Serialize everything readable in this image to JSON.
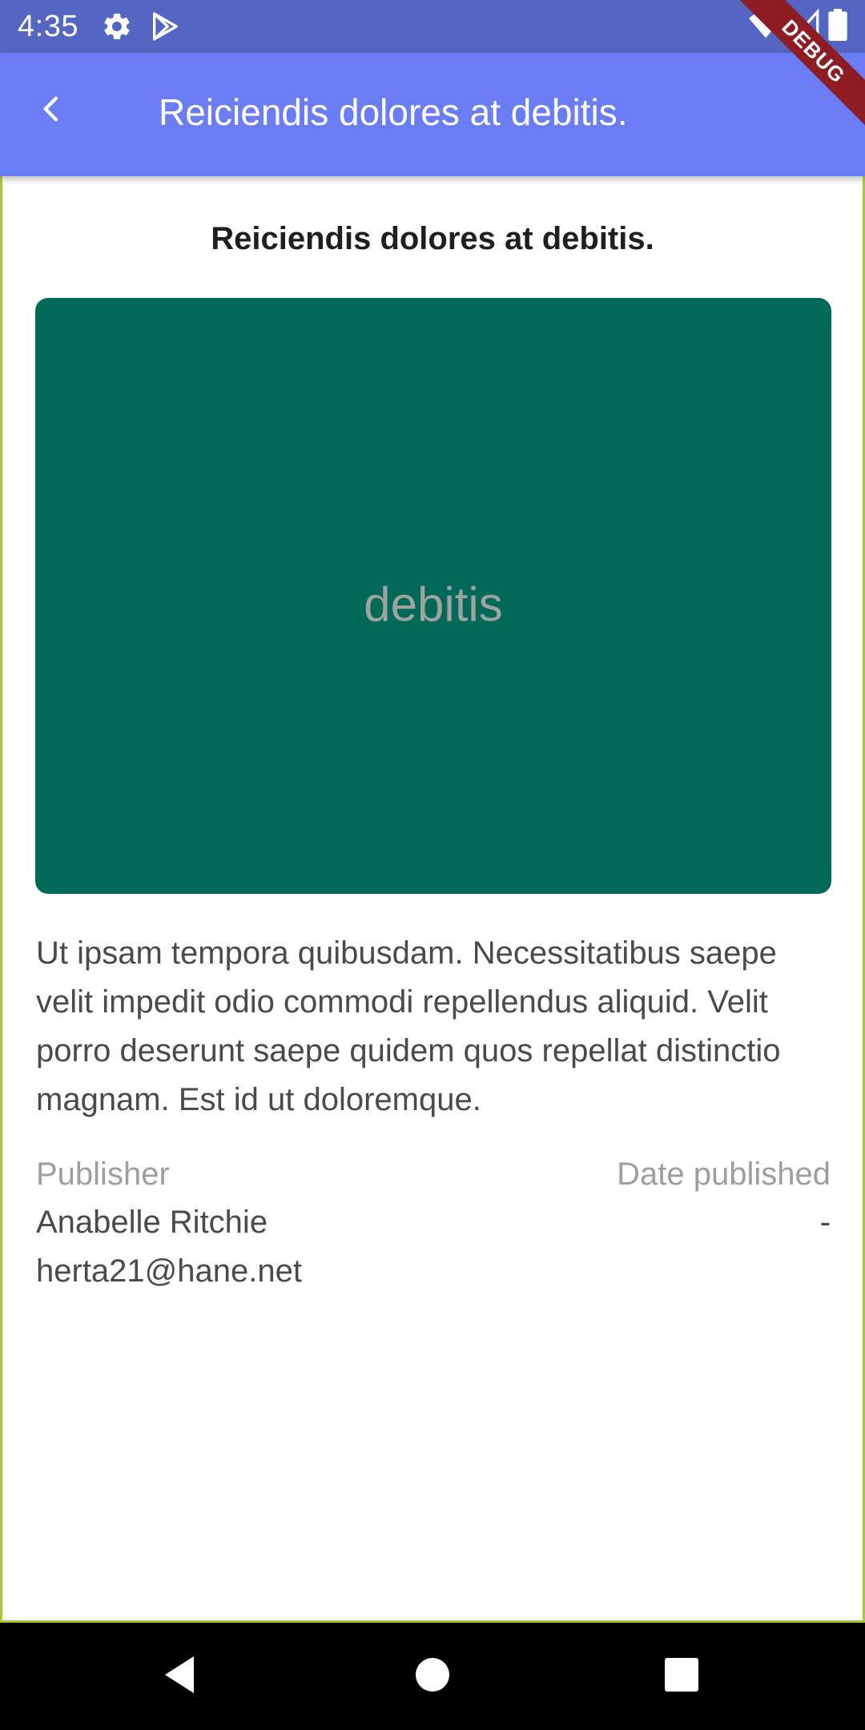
{
  "status_bar": {
    "time": "4:35",
    "left_icons": [
      "gear-icon",
      "play-store-icon"
    ],
    "right_icons": [
      "wifi-icon",
      "signal-icon",
      "battery-icon"
    ]
  },
  "app_bar": {
    "title": "Reiciendis dolores at debitis.",
    "back_icon": "chevron-left-icon",
    "color": "#6a7df5"
  },
  "debug_banner": "DEBUG",
  "article": {
    "heading": "Reiciendis dolores at debitis.",
    "image": {
      "caption": "debitis",
      "background": "#006957"
    },
    "body": "Ut ipsam tempora quibusdam. Necessitatibus saepe velit impedit odio commodi repellendus aliquid. Velit porro deserunt saepe quidem quos repellat distinctio magnam. Est id ut doloremque.",
    "publisher_label": "Publisher",
    "publisher_name": "Anabelle Ritchie",
    "publisher_email": "herta21@hane.net",
    "date_label": "Date published",
    "date_value": "-"
  },
  "nav_bar": {
    "buttons": [
      "back-triangle-icon",
      "home-circle-icon",
      "recents-square-icon"
    ]
  }
}
